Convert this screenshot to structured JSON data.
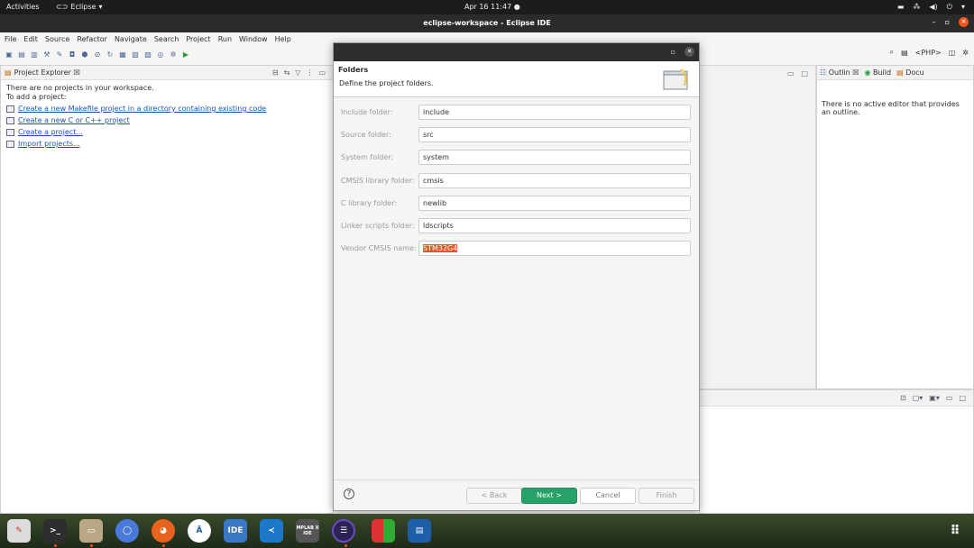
{
  "topbar": {
    "activities": "Activities",
    "app_name": "Eclipse",
    "clock": "Apr 16  11:47"
  },
  "window": {
    "title": "eclipse-workspace - Eclipse IDE"
  },
  "menu": [
    "File",
    "Edit",
    "Source",
    "Refactor",
    "Navigate",
    "Search",
    "Project",
    "Run",
    "Window",
    "Help"
  ],
  "toolbar": {
    "perspective_label": "<PHP>"
  },
  "explorer": {
    "tab_label": "Project Explorer",
    "empty_line1": "There are no projects in your workspace.",
    "empty_line2": "To add a project:",
    "links": [
      "Create a new Makefile project in a directory containing existing code",
      "Create a new C or C++ project",
      "Create a project...",
      "Import projects..."
    ]
  },
  "outline": {
    "tabs": [
      "Outlin",
      "Build",
      "Docu"
    ],
    "message": "There is no active editor that provides an outline."
  },
  "dialog": {
    "heading": "Folders",
    "subheading": "Define the project folders.",
    "fields": [
      {
        "label": "Include folder:",
        "value": "include"
      },
      {
        "label": "Source folder:",
        "value": "src"
      },
      {
        "label": "System folder:",
        "value": "system"
      },
      {
        "label": "CMSIS library folder:",
        "value": "cmsis"
      },
      {
        "label": "C library folder:",
        "value": "newlib"
      },
      {
        "label": "Linker scripts folder:",
        "value": "ldscripts"
      },
      {
        "label": "Vendor CMSIS name:",
        "value": "STM32G4"
      }
    ],
    "buttons": {
      "back": "< Back",
      "next": "Next >",
      "cancel": "Cancel",
      "finish": "Finish"
    },
    "help": "?"
  },
  "dock": {
    "ide_label": "IDE",
    "mplab_label": "MPLAB X IDE"
  },
  "colors": {
    "accent": "#e95420",
    "primary_button": "#26a269",
    "link": "#1a4fbf"
  }
}
